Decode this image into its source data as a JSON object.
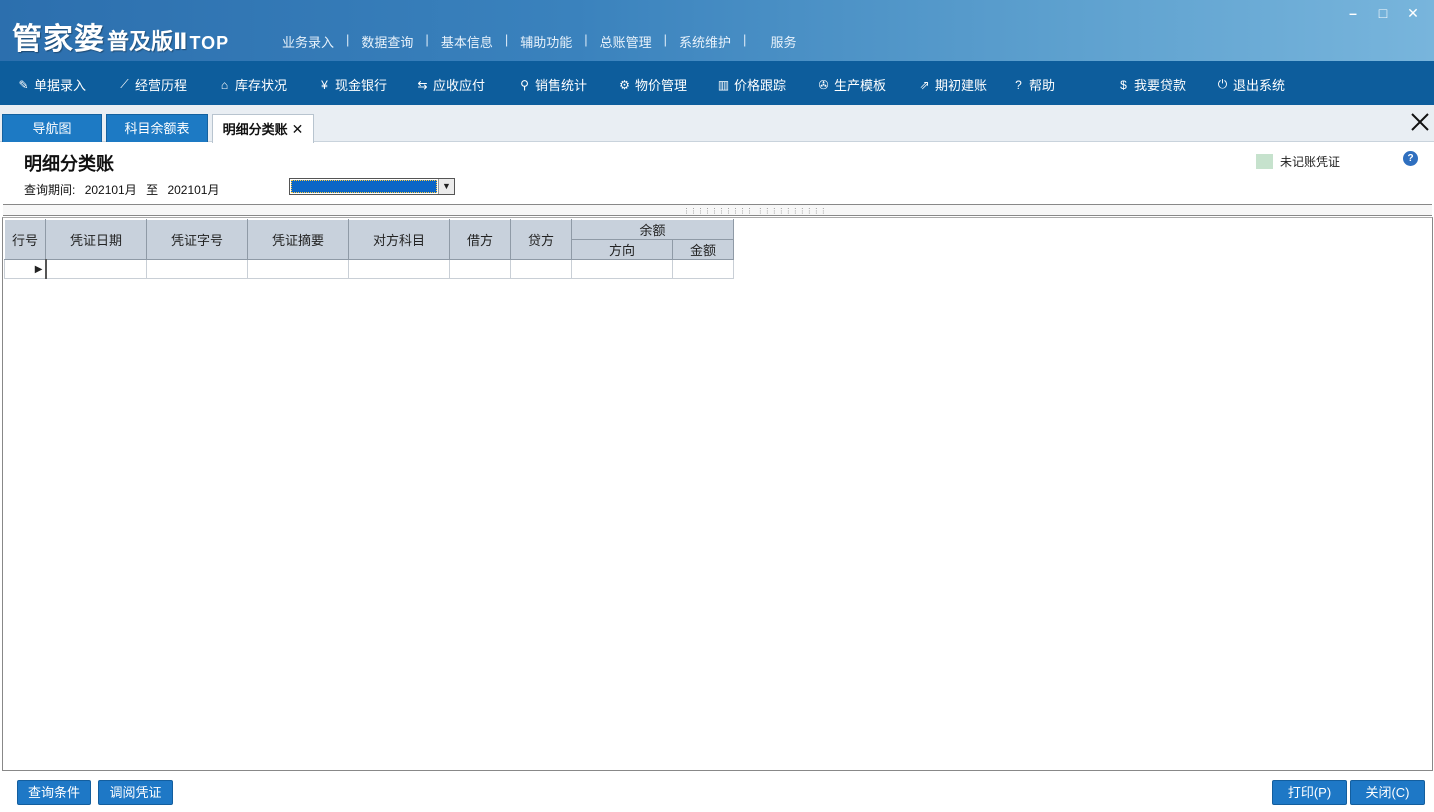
{
  "app": {
    "logo_main": "管家婆",
    "logo_sub": "普及版Ⅱ",
    "logo_top": "TOP",
    "top_menu": [
      "业务录入",
      "数据查询",
      "基本信息",
      "辅助功能",
      "总账管理",
      "系统维护",
      "服务"
    ],
    "window_controls": {
      "minimize": "–",
      "maximize": "□",
      "close": "✕"
    }
  },
  "toolbar": {
    "items": [
      {
        "label": "单据录入",
        "icon": "document-edit-icon",
        "glyph": "✎"
      },
      {
        "label": "经营历程",
        "icon": "line-chart-icon",
        "glyph": "⟋"
      },
      {
        "label": "库存状况",
        "icon": "home-icon",
        "glyph": "⌂"
      },
      {
        "label": "现金银行",
        "icon": "yen-icon",
        "glyph": "¥"
      },
      {
        "label": "应收应付",
        "icon": "exchange-arrows-icon",
        "glyph": "⇆"
      },
      {
        "label": "销售统计",
        "icon": "search-icon",
        "glyph": "⚲"
      },
      {
        "label": "物价管理",
        "icon": "gear-icon",
        "glyph": "⚙"
      },
      {
        "label": "价格跟踪",
        "icon": "bar-chart-icon",
        "glyph": "▥"
      },
      {
        "label": "生产模板",
        "icon": "wrench-icon",
        "glyph": "✇"
      },
      {
        "label": "期初建账",
        "icon": "external-link-icon",
        "glyph": "⇗"
      },
      {
        "label": "帮助",
        "icon": "question-icon",
        "glyph": "?"
      },
      {
        "label": "我要贷款",
        "icon": "money-bag-icon",
        "glyph": "$"
      },
      {
        "label": "退出系统",
        "icon": "power-icon",
        "glyph": "⏻"
      }
    ]
  },
  "tabs": [
    {
      "label": "导航图"
    },
    {
      "label": "科目余额表"
    },
    {
      "label": "明细分类账",
      "close": "✕"
    }
  ],
  "page": {
    "title": "明细分类账",
    "period_label": "查询期间:",
    "period_from": "202101月",
    "period_to_word": "至",
    "period_to": "202101月",
    "legend_label": "未记账凭证",
    "legend_color": "#c6e2cd",
    "help": "?"
  },
  "grid": {
    "headers": [
      "行号",
      "凭证日期",
      "凭证字号",
      "凭证摘要",
      "对方科目",
      "借方",
      "贷方"
    ],
    "group_header": "余额",
    "sub_headers": [
      "方向",
      "金额"
    ],
    "current_row_marker": "▶"
  },
  "buttons": {
    "query": "查询条件",
    "view_voucher": "调阅凭证",
    "print": "打印(P)",
    "close": "关闭(C)"
  }
}
